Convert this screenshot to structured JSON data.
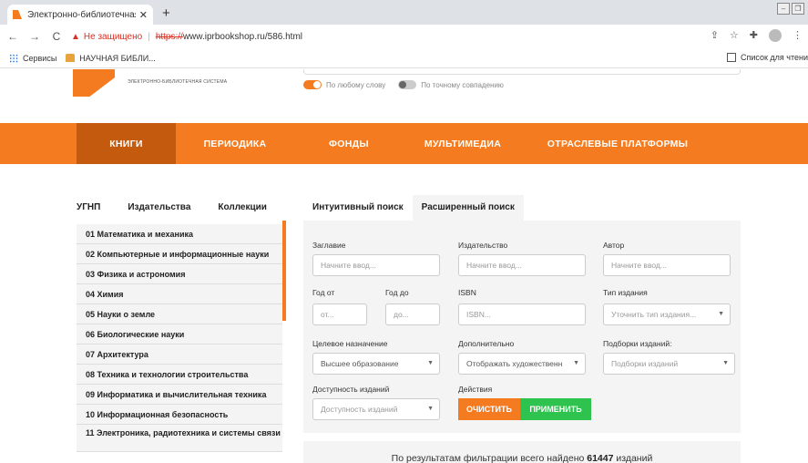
{
  "browser": {
    "tab_title": "Электронно-библиотечная сист",
    "tab_close": "✕",
    "new_tab": "+",
    "nav": {
      "back": "←",
      "forward": "→",
      "reload": "C"
    },
    "security_label": "Не защищено",
    "url_protocol": "https://",
    "url_rest": "www.iprbookshop.ru/586.html",
    "bookmarks": [
      {
        "label": "Сервисы",
        "icon": "apps-grid-icon"
      },
      {
        "label": "НАУЧНАЯ БИБЛИ...",
        "icon": "library-icon"
      }
    ],
    "reading_list": "Список для чтени"
  },
  "header": {
    "logo_subtitle": "ЭЛЕКТРОННО-БИБЛИОТЕЧНАЯ СИСТЕМА",
    "toggle_any_word": "По любому слову",
    "toggle_exact": "По точному совпадению"
  },
  "main_nav": [
    {
      "label": "КНИГИ",
      "active": true
    },
    {
      "label": "ПЕРИОДИКА"
    },
    {
      "label": "ФОНДЫ"
    },
    {
      "label": "МУЛЬТИМЕДИА"
    },
    {
      "label": "ОТРАСЛЕВЫЕ ПЛАТФОРМЫ"
    }
  ],
  "left_tabs": [
    "УГНП",
    "Издательства",
    "Коллекции"
  ],
  "categories": [
    "01 Математика и механика",
    "02 Компьютерные и информационные науки",
    "03 Физика и астрономия",
    "04 Химия",
    "05 Науки о земле",
    "06 Биологические науки",
    "07 Архитектура",
    "08 Техника и технологии строительства",
    "09 Информатика и вычислительная техника",
    "10 Информационная безопасность",
    "11 Электроника, радиотехника и системы связи"
  ],
  "search_tabs": [
    "Интуитивный поиск",
    "Расширенный поиск"
  ],
  "filter": {
    "title_label": "Заглавие",
    "title_placeholder": "Начните ввод...",
    "publisher_label": "Издательство",
    "publisher_placeholder": "Начните ввод...",
    "author_label": "Автор",
    "author_placeholder": "Начните ввод...",
    "year_from_label": "Год от",
    "year_from_placeholder": "от...",
    "year_to_label": "Год до",
    "year_to_placeholder": "до...",
    "isbn_label": "ISBN",
    "isbn_placeholder": "ISBN...",
    "pubtype_label": "Тип издания",
    "pubtype_placeholder": "Уточнить тип издания...",
    "purpose_label": "Целевое назначение",
    "purpose_value": "Высшее образование",
    "extra_label": "Дополнительно",
    "extra_value": "Отображать художественн",
    "collections_label": "Подборки изданий:",
    "collections_placeholder": "Подборки изданий",
    "availability_label": "Доступность изданий",
    "availability_placeholder": "Доступность изданий",
    "actions_label": "Действия",
    "clear_button": "ОЧИСТИТЬ",
    "apply_button": "ПРИМЕНИТЬ"
  },
  "results": {
    "prefix": "По результатам фильтрации всего найдено",
    "count": "61447",
    "suffix": "изданий"
  },
  "colors": {
    "brand": "#f47b20",
    "brand_dark": "#c45a0d",
    "apply": "#2ec24f"
  }
}
